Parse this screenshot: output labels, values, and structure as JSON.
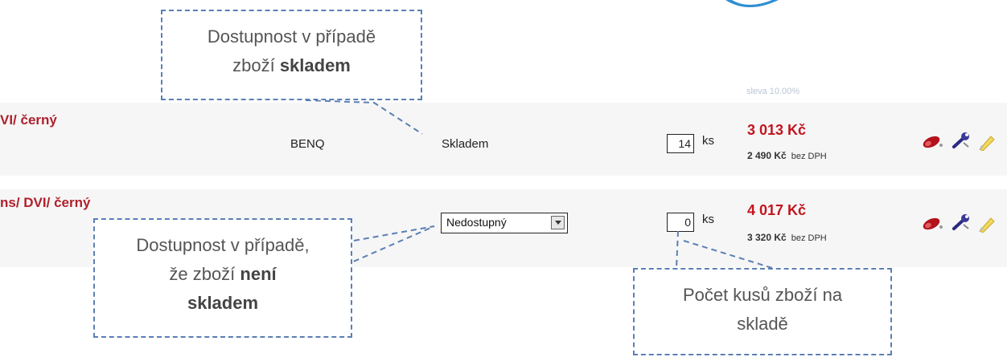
{
  "sleva": "sleva 10.00%",
  "rows": [
    {
      "name": "VI/ černý",
      "brand": "BENQ",
      "availability": "Skladem",
      "qty": "14",
      "unit": "ks",
      "price": "3 013 Kč",
      "price_net_value": "2 490 Kč",
      "price_net_note": "bez DPH"
    },
    {
      "name": "ns/ DVI/ černý",
      "availability_select": "Nedostupný",
      "qty": "0",
      "unit": "ks",
      "price": "4 017 Kč",
      "price_net_value": "3 320 Kč",
      "price_net_note": "bez DPH"
    }
  ],
  "callouts": {
    "in_stock": {
      "line1": "Dostupnost v případě",
      "line2_prefix": "zboží ",
      "line2_bold": "skladem"
    },
    "not_in_stock": {
      "line1": "Dostupnost v případě,",
      "line2_prefix": "že zboží ",
      "line2_bold": "není",
      "line3_bold": "skladem"
    },
    "stock_count": {
      "line1": "Počet kusů zboží na",
      "line2": "skladě"
    }
  },
  "colors": {
    "accent_red": "#c2151f",
    "callout_border": "#5b7fb4"
  },
  "icons": [
    "eraser-icon",
    "wrench-icon",
    "pencil-icon"
  ]
}
